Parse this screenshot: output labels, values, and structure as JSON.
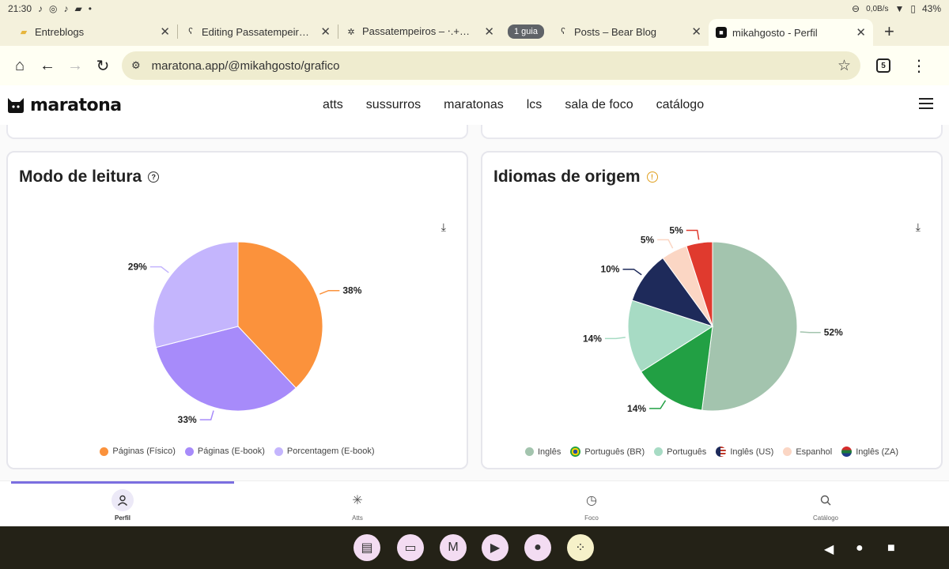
{
  "status_bar": {
    "time": "21:30",
    "net_speed": "0,0B/s",
    "battery": "43%"
  },
  "tabs": [
    {
      "label": "Entreblogs",
      "icon": "folder-icon"
    },
    {
      "label": "Editing Passatempeiros – B",
      "icon": "bear-icon"
    },
    {
      "label": "Passatempeiros – ⋅.+⊕,˚. D",
      "icon": "sparkle-icon"
    },
    {
      "group_chip": "1 guia"
    },
    {
      "label": "Posts – Bear Blog",
      "icon": "bear-icon"
    },
    {
      "label": "mikahgosto - Perfil",
      "icon": "maratona-icon"
    }
  ],
  "omnibox": {
    "url": "maratona.app/@mikahgosto/grafico",
    "tab_count": "5"
  },
  "site": {
    "logo_text": "maratona",
    "nav": [
      "atts",
      "sussurros",
      "maratonas",
      "lcs",
      "sala de foco",
      "catálogo"
    ]
  },
  "cards": {
    "reading_mode": {
      "title": "Modo de leitura",
      "legend": [
        {
          "label": "Páginas (Físico)",
          "color": "#fb923c"
        },
        {
          "label": "Páginas (E-book)",
          "color": "#a78bfa"
        },
        {
          "label": "Porcentagem (E-book)",
          "color": "#c4b5fd"
        }
      ]
    },
    "origin_languages": {
      "title": "Idiomas de origem",
      "legend": [
        {
          "label": "Inglês",
          "color": "#a3c4ae"
        },
        {
          "label": "Português (BR)",
          "color": "#22a044"
        },
        {
          "label": "Português",
          "color": "#a7dbc4"
        },
        {
          "label": "Inglês (US)",
          "color": "#1e2a5a"
        },
        {
          "label": "Espanhol",
          "color": "#fbd6c4"
        },
        {
          "label": "Inglês (ZA)",
          "color": "#1d7a3a"
        }
      ]
    }
  },
  "chart_data": [
    {
      "type": "pie",
      "title": "Modo de leitura",
      "categories": [
        "Páginas (Físico)",
        "Páginas (E-book)",
        "Porcentagem (E-book)"
      ],
      "values": [
        38,
        33,
        29
      ],
      "labels": [
        "38%",
        "33%",
        "29%"
      ],
      "colors": [
        "#fb923c",
        "#a78bfa",
        "#c4b5fd"
      ],
      "legend": "bottom"
    },
    {
      "type": "pie",
      "title": "Idiomas de origem",
      "categories": [
        "Inglês",
        "Português (BR)",
        "Português",
        "Inglês (US)",
        "Espanhol",
        "Inglês (ZA)"
      ],
      "values": [
        52,
        14,
        14,
        10,
        5,
        5
      ],
      "labels": [
        "52%",
        "14%",
        "14%",
        "10%",
        "5%",
        "5%"
      ],
      "colors": [
        "#a3c4ae",
        "#22a044",
        "#a7dbc4",
        "#1e2a5a",
        "#fbd6c4",
        "#e03a2e"
      ],
      "legend": "bottom"
    }
  ],
  "app_nav": [
    {
      "label": "Perfil",
      "icon": "user-icon"
    },
    {
      "label": "Atts",
      "icon": "loader-icon"
    },
    {
      "label": "Foco",
      "icon": "clock-icon"
    },
    {
      "label": "Catálogo",
      "icon": "search-icon"
    }
  ]
}
